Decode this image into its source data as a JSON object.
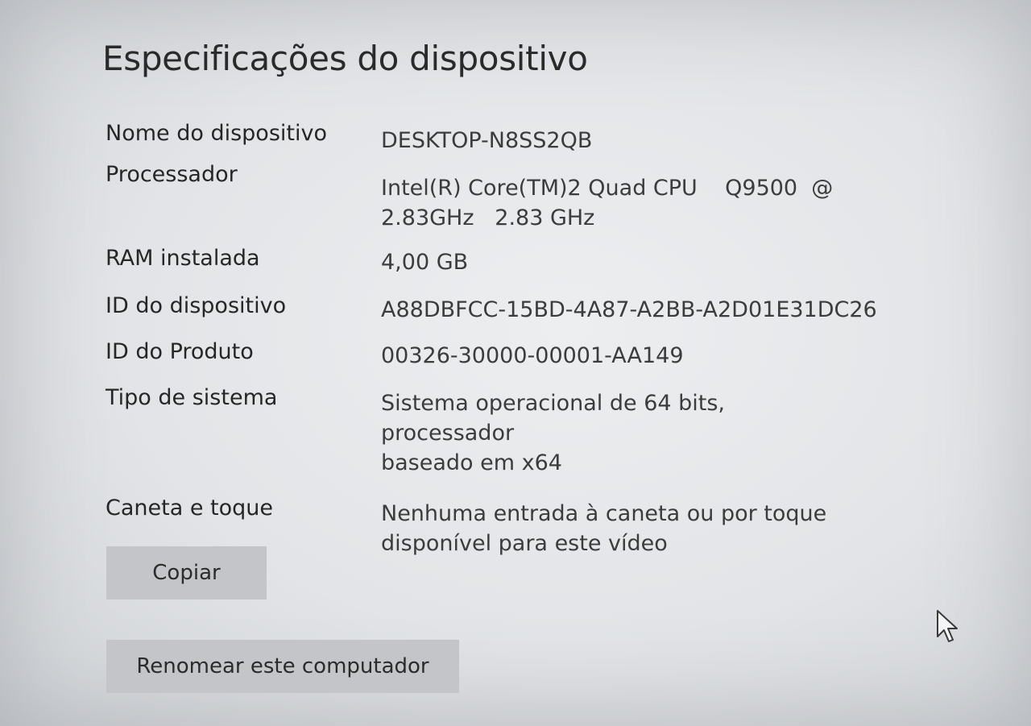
{
  "page": {
    "title": "Especificações do dispositivo"
  },
  "specs": [
    {
      "label": "Nome do dispositivo",
      "value": "DESKTOP-N8SS2QB"
    },
    {
      "label": "Processador",
      "value": "Intel(R) Core(TM)2 Quad CPU    Q9500  @\n2.83GHz   2.83 GHz"
    },
    {
      "label": "RAM instalada",
      "value": "4,00 GB"
    },
    {
      "label": "ID do dispositivo",
      "value": "A88DBFCC-15BD-4A87-A2BB-A2D01E31DC26"
    },
    {
      "label": "ID do Produto",
      "value": "00326-30000-00001-AA149"
    },
    {
      "label": "Tipo de sistema",
      "value": "Sistema operacional de 64 bits, processador\nbaseado em x64"
    },
    {
      "label": "Caneta e toque",
      "value": "Nenhuma entrada à caneta ou por toque\ndisponível para este vídeo"
    }
  ],
  "buttons": {
    "copy_label": "Copiar",
    "rename_label": "Renomear este computador"
  },
  "icons": {
    "pointer": "mouse-pointer-icon"
  },
  "colors": {
    "background": "#e6e8eb",
    "button_bg": "#c3c5c8",
    "text": "#2b2b2b"
  }
}
